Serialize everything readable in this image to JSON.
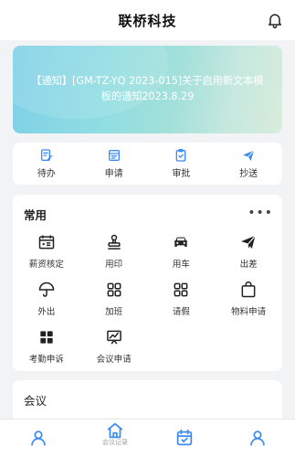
{
  "header": {
    "title": "联桥科技",
    "icon": "bell-icon"
  },
  "banner": {
    "text": "【通知】[GM-TZ-YQ 2023-015]关于启用新文本模板的通知2023.8.29"
  },
  "quick": [
    {
      "label": "待办",
      "icon": "todo-icon"
    },
    {
      "label": "申请",
      "icon": "apply-icon"
    },
    {
      "label": "审批",
      "icon": "approve-icon"
    },
    {
      "label": "抄送",
      "icon": "send-icon"
    }
  ],
  "common": {
    "title": "常用",
    "more": "•••",
    "items": [
      {
        "label": "薪资核定",
        "icon": "salary-calendar-icon"
      },
      {
        "label": "用印",
        "icon": "stamp-icon"
      },
      {
        "label": "用车",
        "icon": "car-icon"
      },
      {
        "label": "出差",
        "icon": "paper-plane-icon"
      },
      {
        "label": "外出",
        "icon": "umbrella-icon"
      },
      {
        "label": "加班",
        "icon": "overtime-grid-icon"
      },
      {
        "label": "请假",
        "icon": "leave-grid-icon"
      },
      {
        "label": "物料申请",
        "icon": "bag-icon"
      },
      {
        "label": "考勤申诉",
        "icon": "apps-grid-icon"
      },
      {
        "label": "会议申请",
        "icon": "chart-board-icon"
      }
    ]
  },
  "meeting": {
    "title": "会议"
  },
  "nav": {
    "home_label": "会议记录",
    "items": [
      "person-icon",
      "home-icon",
      "calendar-icon",
      "user-icon"
    ]
  },
  "colors": {
    "accent": "#3d8bf2",
    "banner_start": "#7fd0e8",
    "banner_end": "#d9ecdb"
  }
}
